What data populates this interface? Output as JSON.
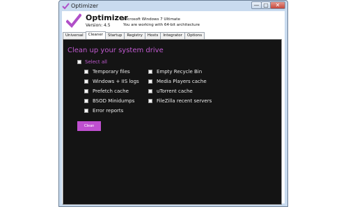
{
  "window": {
    "title": "Optimizer",
    "controls": {
      "minimize": "—",
      "maximize": "▢",
      "close": "✕"
    }
  },
  "header": {
    "app_name": "Optimizer",
    "version": "Version: 4.5",
    "os": "Microsoft Windows 7 Ultimate",
    "architecture": "You are working with 64-bit architecture"
  },
  "tabs": [
    {
      "label": "Universal",
      "active": false
    },
    {
      "label": "Cleaner",
      "active": true
    },
    {
      "label": "Startup",
      "active": false
    },
    {
      "label": "Registry",
      "active": false
    },
    {
      "label": "Hosts",
      "active": false
    },
    {
      "label": "Integrator",
      "active": false
    },
    {
      "label": "Options",
      "active": false
    }
  ],
  "cleaner": {
    "heading": "Clean up your system drive",
    "select_all": "Select all",
    "left_options": [
      "Temporary files",
      "Windows + IIS logs",
      "Prefetch cache",
      "BSOD Minidumps",
      "Error reports"
    ],
    "right_options": [
      "Empty Recycle Bin",
      "Media Players cache",
      "uTorrent cache",
      "FileZilla recent servers"
    ],
    "clean_button": "Clean"
  },
  "colors": {
    "accent": "#c05ad0",
    "panel_bg": "#141414",
    "window_frame": "#c9dbef"
  }
}
